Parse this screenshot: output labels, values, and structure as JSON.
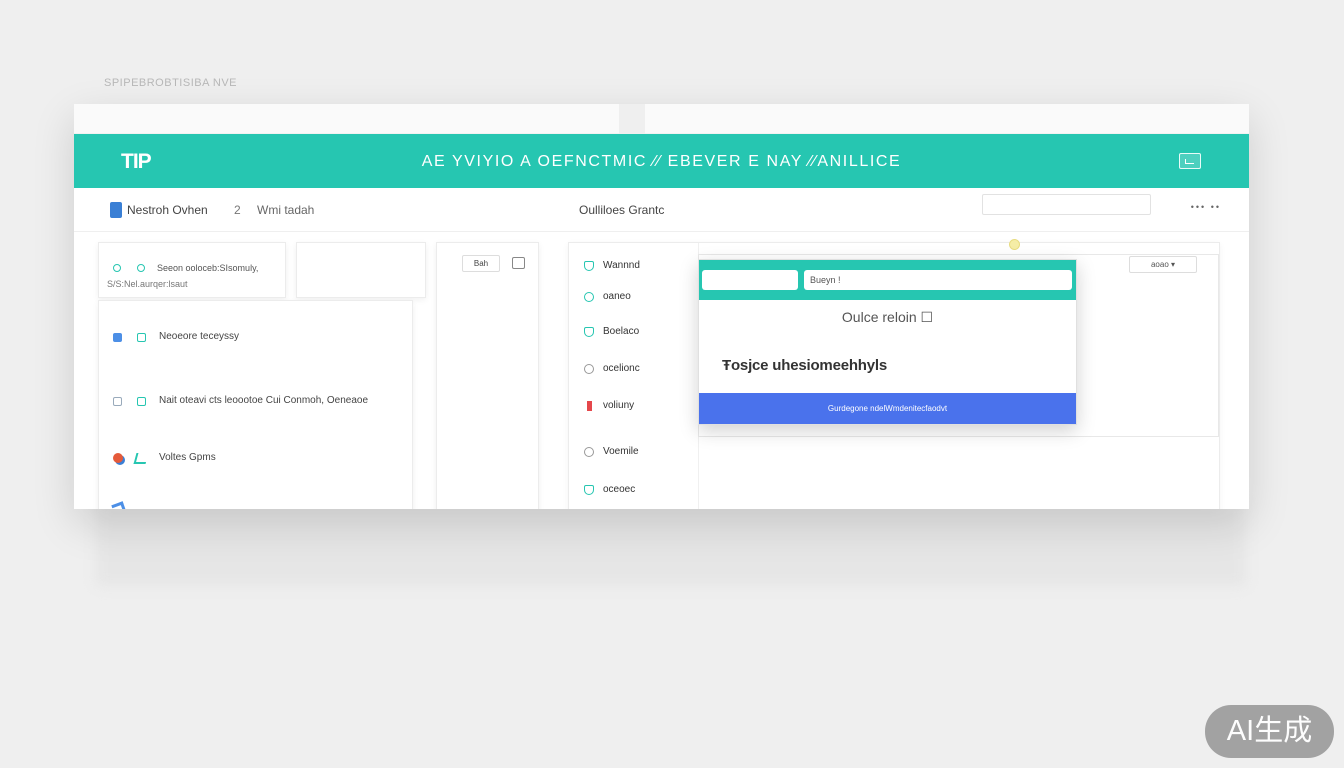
{
  "caption": "SPIPEBROBTISIBA NVE",
  "app": {
    "logo": "TIP",
    "banner_title": "AE YVIYIO A OEFNCTMIC ∕∕ EBEVER E NAY ∕∕ANILLICE",
    "banner_icon": "image-icon",
    "brand_color": "#26c6b1",
    "accent_blue": "#4a72ec"
  },
  "subbar": {
    "left_label": "Nestroh Ovhen",
    "number": "2",
    "left_label_2": "Wmi tadah",
    "center_label": "Oulliloes Grantc",
    "menu_dots": "••• ••"
  },
  "card_top": {
    "line1": "Seeon ooloceb:SIsomuly,",
    "line2": "S/S:Nel.aurqer:lsaut"
  },
  "list_rows": [
    {
      "label": "Neoeore teceyssy"
    },
    {
      "label": "Nait oteavi cts leoootoe Cui Conmoh, Oeneaoe"
    },
    {
      "label": "Voltes Gpms"
    },
    {
      "label": ""
    }
  ],
  "mini_card": {
    "pill": "Bah"
  },
  "nav_items": [
    {
      "label": "Wannnd",
      "icon": "user-icon"
    },
    {
      "label": "oaneo",
      "icon": "circle-icon"
    },
    {
      "label": "Boelaco",
      "icon": "user-icon"
    },
    {
      "label": "ocelionc",
      "icon": "search-icon"
    },
    {
      "label": "voliuny",
      "icon": "flag-icon"
    },
    {
      "label": "Voemile",
      "icon": "search-icon"
    },
    {
      "label": "oceoec",
      "icon": "user-icon"
    }
  ],
  "inner_pill": "aoao  ▾",
  "dialog": {
    "input_text": "Bueyn !",
    "subtitle": "Oulce reloin ☐",
    "main_text": "Ŧosjce uhesiomeehhyls",
    "button": "Gurdegone ndelWmdenitecfaodvt"
  },
  "watermark": "AI生成"
}
